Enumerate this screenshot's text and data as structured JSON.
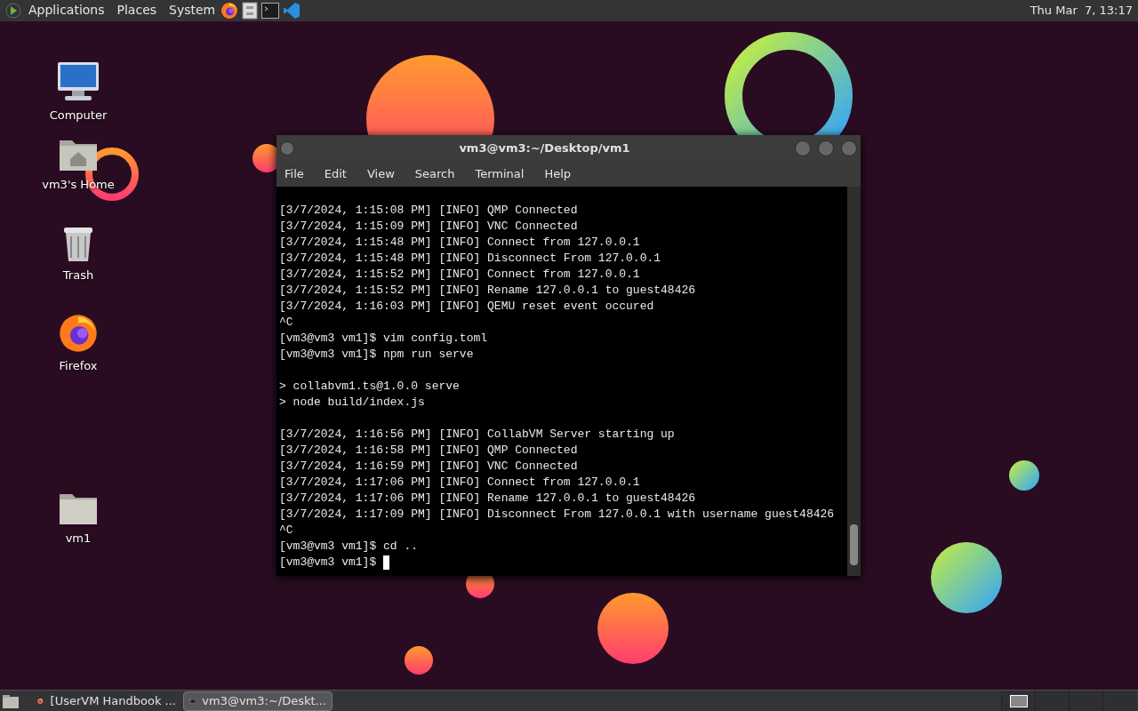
{
  "top_panel": {
    "menus": [
      "Applications",
      "Places",
      "System"
    ],
    "clock": "Thu Mar  7, 13:17"
  },
  "desktop_icons": [
    {
      "label": "Computer",
      "kind": "computer"
    },
    {
      "label": "vm3's Home",
      "kind": "home"
    },
    {
      "label": "Trash",
      "kind": "trash"
    },
    {
      "label": "Firefox",
      "kind": "firefox"
    },
    {
      "label": "vm1",
      "kind": "folder"
    }
  ],
  "terminal": {
    "title": "vm3@vm3:~/Desktop/vm1",
    "menu": [
      "File",
      "Edit",
      "View",
      "Search",
      "Terminal",
      "Help"
    ],
    "lines": [
      "[3/7/2024, 1:15:08 PM] [INFO] QMP Connected",
      "[3/7/2024, 1:15:09 PM] [INFO] VNC Connected",
      "[3/7/2024, 1:15:48 PM] [INFO] Connect from 127.0.0.1",
      "[3/7/2024, 1:15:48 PM] [INFO] Disconnect From 127.0.0.1",
      "[3/7/2024, 1:15:52 PM] [INFO] Connect from 127.0.0.1",
      "[3/7/2024, 1:15:52 PM] [INFO] Rename 127.0.0.1 to guest48426",
      "[3/7/2024, 1:16:03 PM] [INFO] QEMU reset event occured",
      "^C",
      "[vm3@vm3 vm1]$ vim config.toml",
      "[vm3@vm3 vm1]$ npm run serve",
      {
        "kind": "blank"
      },
      "> collabvm1.ts@1.0.0 serve",
      "> node build/index.js",
      {
        "kind": "blank"
      },
      "[3/7/2024, 1:16:56 PM] [INFO] CollabVM Server starting up",
      "[3/7/2024, 1:16:58 PM] [INFO] QMP Connected",
      "[3/7/2024, 1:16:59 PM] [INFO] VNC Connected",
      "[3/7/2024, 1:17:06 PM] [INFO] Connect from 127.0.0.1",
      "[3/7/2024, 1:17:06 PM] [INFO] Rename 127.0.0.1 to guest48426",
      "[3/7/2024, 1:17:09 PM] [INFO] Disconnect From 127.0.0.1 with username guest48426",
      "^C",
      "[vm3@vm3 vm1]$ cd ..",
      "[vm3@vm3 vm1]$"
    ]
  },
  "taskbar": {
    "tasks": [
      {
        "label": "[UserVM Handbook ...",
        "kind": "browser",
        "selected": false
      },
      {
        "label": "vm3@vm3:~/Deskt...",
        "kind": "terminal",
        "selected": true
      }
    ],
    "workspaces": [
      {
        "selected": true
      },
      {
        "selected": false
      },
      {
        "selected": false
      },
      {
        "selected": false
      }
    ]
  }
}
